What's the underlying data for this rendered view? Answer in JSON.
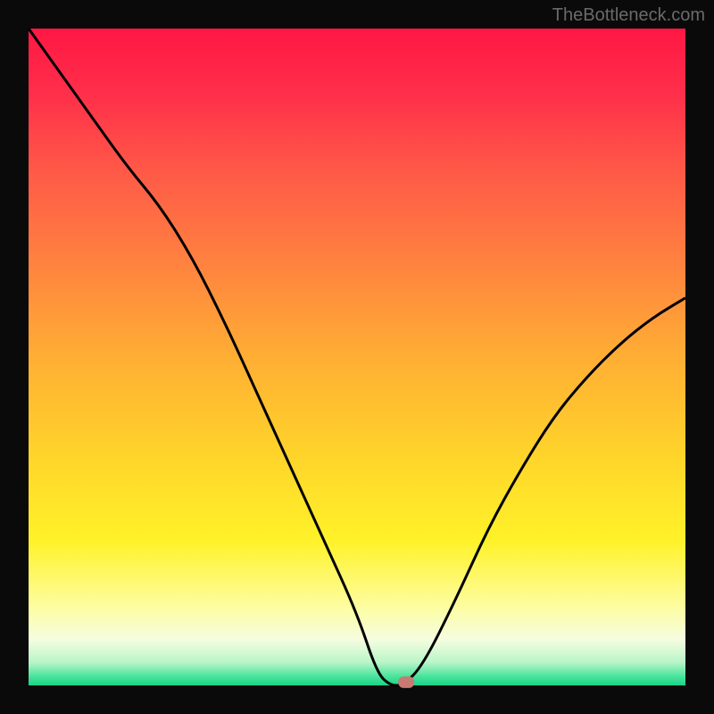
{
  "watermark": "TheBottleneck.com",
  "chart_data": {
    "type": "line",
    "title": "",
    "xlabel": "",
    "ylabel": "",
    "xlim": [
      0,
      100
    ],
    "ylim": [
      0,
      100
    ],
    "x": [
      0,
      5,
      10,
      15,
      20,
      25,
      30,
      35,
      40,
      45,
      50,
      53,
      55,
      57,
      60,
      65,
      70,
      75,
      80,
      85,
      90,
      95,
      100
    ],
    "values": [
      100,
      93,
      86,
      79,
      73,
      65,
      55,
      44,
      33,
      22,
      11,
      2,
      0,
      0,
      3,
      13,
      24,
      33,
      41,
      47,
      52,
      56,
      59
    ],
    "marker": {
      "x": 57.5,
      "y": 0.5
    },
    "gradient_stops": [
      {
        "offset": 0.0,
        "color": "#ff1744"
      },
      {
        "offset": 0.1,
        "color": "#ff2f4a"
      },
      {
        "offset": 0.22,
        "color": "#ff5a47"
      },
      {
        "offset": 0.35,
        "color": "#ff8040"
      },
      {
        "offset": 0.5,
        "color": "#ffae34"
      },
      {
        "offset": 0.65,
        "color": "#ffd42a"
      },
      {
        "offset": 0.78,
        "color": "#fff229"
      },
      {
        "offset": 0.88,
        "color": "#fdfda0"
      },
      {
        "offset": 0.93,
        "color": "#f5fde0"
      },
      {
        "offset": 0.965,
        "color": "#b8f5c8"
      },
      {
        "offset": 0.985,
        "color": "#4fe59e"
      },
      {
        "offset": 1.0,
        "color": "#17d487"
      }
    ],
    "background": "#0a0a0a",
    "line_color": "#000000",
    "marker_color": "#c97a72"
  }
}
